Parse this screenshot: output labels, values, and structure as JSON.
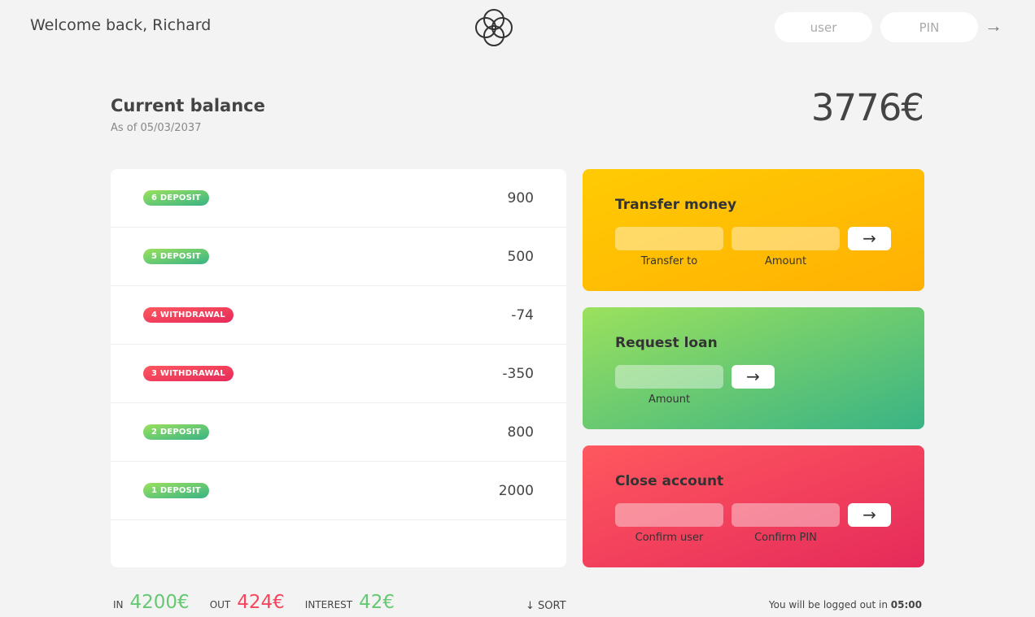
{
  "nav": {
    "welcome": "Welcome back, Richard",
    "user_placeholder": "user",
    "pin_placeholder": "PIN",
    "login_arrow": "→"
  },
  "balance": {
    "label": "Current balance",
    "date": "As of 05/03/2037",
    "value": "3776€"
  },
  "movements": [
    {
      "type_label": "6 DEPOSIT",
      "kind": "deposit",
      "value": "900"
    },
    {
      "type_label": "5 DEPOSIT",
      "kind": "deposit",
      "value": "500"
    },
    {
      "type_label": "4 WITHDRAWAL",
      "kind": "withdrawal",
      "value": "-74"
    },
    {
      "type_label": "3 WITHDRAWAL",
      "kind": "withdrawal",
      "value": "-350"
    },
    {
      "type_label": "2 DEPOSIT",
      "kind": "deposit",
      "value": "800"
    },
    {
      "type_label": "1 DEPOSIT",
      "kind": "deposit",
      "value": "2000"
    }
  ],
  "operations": {
    "transfer": {
      "title": "Transfer money",
      "field1_label": "Transfer to",
      "field2_label": "Amount",
      "button": "→"
    },
    "loan": {
      "title": "Request loan",
      "field1_label": "Amount",
      "button": "→"
    },
    "close": {
      "title": "Close account",
      "field1_label": "Confirm user",
      "field2_label": "Confirm PIN",
      "button": "→"
    }
  },
  "summary": {
    "in_label": "In",
    "in_value": "4200€",
    "out_label": "Out",
    "out_value": "424€",
    "interest_label": "Interest",
    "interest_value": "42€",
    "sort_label": "↓ SORT"
  },
  "logout": {
    "text": "You will be logged out in ",
    "timer": "05:00"
  },
  "colors": {
    "deposit": "#39b385",
    "withdrawal": "#e52a5a",
    "transfer": "#ffb003",
    "loan": "#39b385",
    "close": "#e52a5a"
  }
}
